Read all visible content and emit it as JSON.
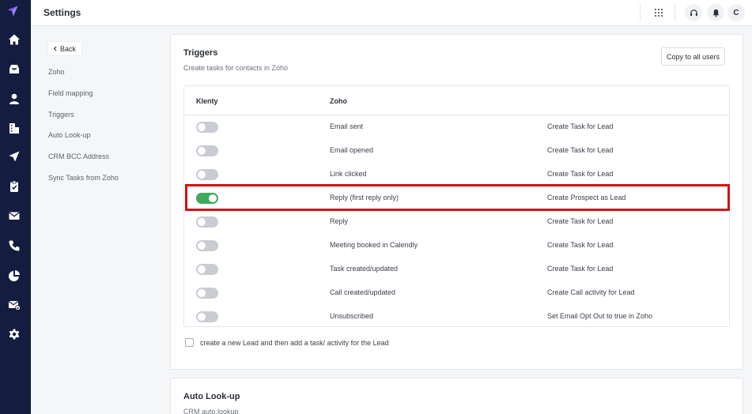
{
  "app": {
    "brand_color": "#7b5cf0",
    "rail_bg": "#141d3f",
    "nav_icons": [
      "home-icon",
      "inbox-icon",
      "person-icon",
      "company-icon",
      "send-icon",
      "clipboard-icon",
      "mail-icon",
      "phone-icon",
      "pie-chart-icon",
      "mail-check-icon",
      "settings-icon"
    ]
  },
  "header": {
    "title": "Settings",
    "avatar_initial": "C",
    "icons": [
      "apps-grid-icon",
      "headset-icon",
      "bell-icon"
    ]
  },
  "subnav": {
    "back_label": "Back",
    "items": [
      "Zoho",
      "Field mapping",
      "Triggers",
      "Auto Look-up",
      "CRM BCC Address",
      "Sync Tasks from Zoho"
    ]
  },
  "triggers": {
    "title": "Triggers",
    "subtitle": "Create tasks for contacts in Zoho",
    "copy_button": "Copy to all users",
    "columns": [
      "Klenty",
      "Zoho"
    ],
    "rows": [
      {
        "trigger": "Email sent",
        "action": "Create Task for Lead",
        "enabled": false
      },
      {
        "trigger": "Email opened",
        "action": "Create Task for Lead",
        "enabled": false
      },
      {
        "trigger": "Link clicked",
        "action": "Create Task for Lead",
        "enabled": false
      },
      {
        "trigger": "Reply (first reply only)",
        "action": "Create Prospect as Lead",
        "enabled": true
      },
      {
        "trigger": "Reply",
        "action": "Create Task for Lead",
        "enabled": false
      },
      {
        "trigger": "Meeting booked in Calendly",
        "action": "Create Task for Lead",
        "enabled": false
      },
      {
        "trigger": "Task created/updated",
        "action": "Create Task for Lead",
        "enabled": false
      },
      {
        "trigger": "Call created/updated",
        "action": "Create Call activity for Lead",
        "enabled": false
      },
      {
        "trigger": "Unsubscribed",
        "action": "Set Email Opt Out to true in Zoho",
        "enabled": false
      }
    ],
    "checkbox_label": "create a new Lead and then add a task/ activity for the Lead",
    "checkbox_checked": false,
    "toggle_on_color": "#3daa5b",
    "highlight_color": "#d40f14"
  },
  "auto_lookup": {
    "title": "Auto Look-up",
    "subtitle": "CRM auto lookup"
  }
}
